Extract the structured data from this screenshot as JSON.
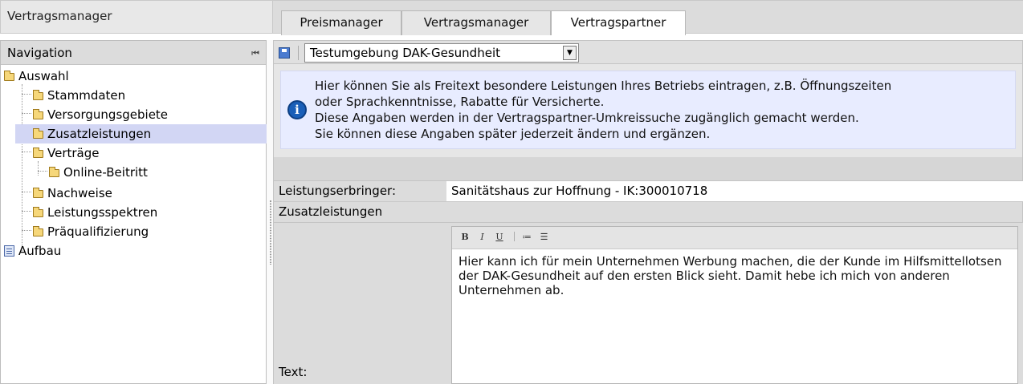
{
  "app": {
    "title": "Vertragsmanager"
  },
  "tabs": [
    {
      "label": "Preismanager"
    },
    {
      "label": "Vertragsmanager"
    },
    {
      "label": "Vertragspartner"
    }
  ],
  "navigation": {
    "title": "Navigation",
    "items": [
      {
        "label": "Auswahl"
      },
      {
        "label": "Stammdaten"
      },
      {
        "label": "Versorgungsgebiete"
      },
      {
        "label": "Zusatzleistungen"
      },
      {
        "label": "Verträge"
      },
      {
        "label": "Online-Beitritt"
      },
      {
        "label": "Nachweise"
      },
      {
        "label": "Leistungsspektren"
      },
      {
        "label": "Präqualifizierung"
      },
      {
        "label": "Aufbau"
      }
    ]
  },
  "toolbar": {
    "environment_value": "Testumgebung DAK-Gesundheit"
  },
  "info": {
    "lines": [
      "Hier können Sie als Freitext besondere Leistungen Ihres Betriebs eintragen, z.B. Öffnungszeiten",
      "oder Sprachkenntnisse, Rabatte für Versicherte.",
      "Diese Angaben werden in der Vertragspartner-Umkreissuche zugänglich gemacht werden.",
      "Sie können diese Angaben später jederzeit ändern und ergänzen."
    ]
  },
  "form": {
    "provider_label": "Leistungserbringer:",
    "provider_value": "Sanitätshaus zur Hoffnung - IK:300010718",
    "section_title": "Zusatzleistungen",
    "text_label": "Text:",
    "editor": {
      "bold": "B",
      "italic": "I",
      "underline": "U",
      "ordered_list": "≔",
      "unordered_list": "☰",
      "content": "Hier kann ich für mein Unternehmen Werbung machen, die der Kunde im Hilfsmittellotsen der DAK-Gesundheit auf den ersten Blick sieht. Damit hebe ich mich von anderen Unternehmen ab."
    }
  }
}
